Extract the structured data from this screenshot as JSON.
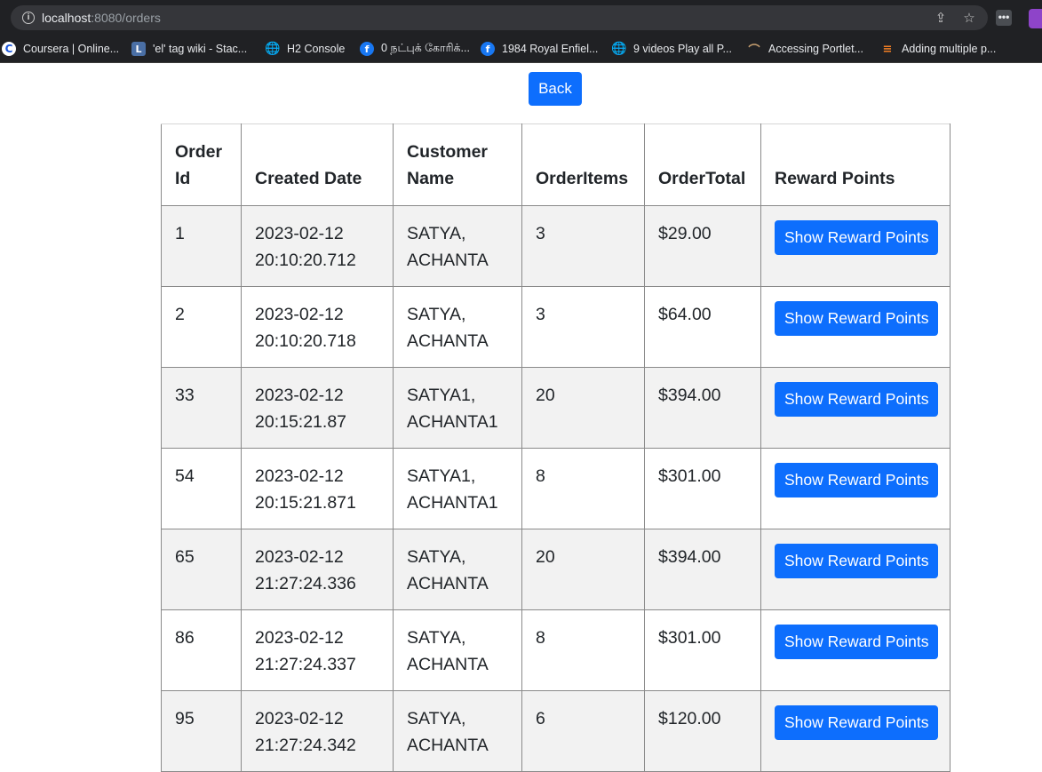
{
  "browser": {
    "url_host": "localhost",
    "url_rest": ":8080/orders",
    "ext_label": "•••",
    "bookmarks": [
      {
        "label": "Coursera | Online...",
        "icon": "coursera-icon"
      },
      {
        "label": "'el' tag wiki - Stac...",
        "icon": "wiki-icon"
      },
      {
        "label": "H2 Console",
        "icon": "globe-icon"
      },
      {
        "label": "0 நட்புக் கோரிக்...",
        "icon": "facebook-icon"
      },
      {
        "label": "1984 Royal Enfiel...",
        "icon": "facebook-icon"
      },
      {
        "label": "9 videos Play all P...",
        "icon": "globe-icon"
      },
      {
        "label": "Accessing Portlet...",
        "icon": "portlet-icon"
      },
      {
        "label": "Adding multiple p...",
        "icon": "stackoverflow-icon"
      }
    ]
  },
  "page": {
    "back_label": "Back",
    "table": {
      "headers": [
        "Order Id",
        "Created Date",
        "Customer Name",
        "OrderItems",
        "OrderTotal",
        "Reward Points"
      ],
      "button_label": "Show Reward Points",
      "rows": [
        {
          "id": "1",
          "date": "2023-02-12 20:10:20.712",
          "name": "SATYA, ACHANTA",
          "items": "3",
          "total": "$29.00"
        },
        {
          "id": "2",
          "date": "2023-02-12 20:10:20.718",
          "name": "SATYA, ACHANTA",
          "items": "3",
          "total": "$64.00"
        },
        {
          "id": "33",
          "date": "2023-02-12 20:15:21.87",
          "name": "SATYA1, ACHANTA1",
          "items": "20",
          "total": "$394.00"
        },
        {
          "id": "54",
          "date": "2023-02-12 20:15:21.871",
          "name": "SATYA1, ACHANTA1",
          "items": "8",
          "total": "$301.00"
        },
        {
          "id": "65",
          "date": "2023-02-12 21:27:24.336",
          "name": "SATYA, ACHANTA",
          "items": "20",
          "total": "$394.00"
        },
        {
          "id": "86",
          "date": "2023-02-12 21:27:24.337",
          "name": "SATYA, ACHANTA",
          "items": "8",
          "total": "$301.00"
        },
        {
          "id": "95",
          "date": "2023-02-12 21:27:24.342",
          "name": "SATYA, ACHANTA",
          "items": "6",
          "total": "$120.00"
        }
      ]
    }
  }
}
